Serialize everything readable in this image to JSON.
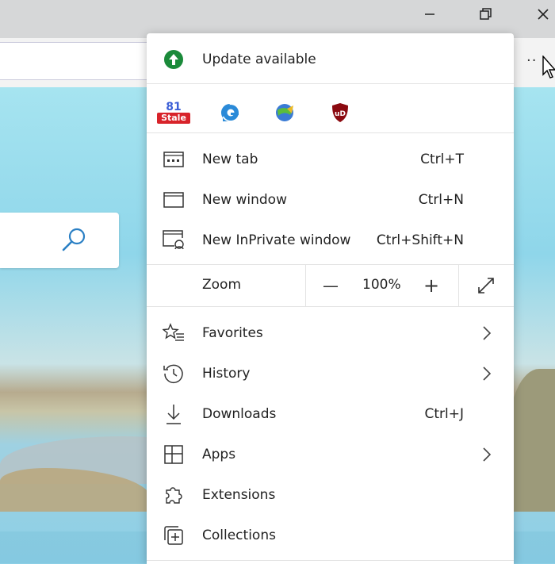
{
  "window": {
    "minimize_icon": "minimize-icon",
    "restore_icon": "restore-icon",
    "close_icon": "close-icon"
  },
  "toolbar": {
    "more_label": "··"
  },
  "menu": {
    "update": {
      "label": "Update available",
      "icon": "update-arrow-icon",
      "color": "#1a8a3a"
    },
    "extensions": [
      {
        "name": "stale-extension",
        "badge_top": "81",
        "badge_bottom": "Stale"
      },
      {
        "name": "edge-extension"
      },
      {
        "name": "idm-extension"
      },
      {
        "name": "ublock-extension",
        "text": "uD"
      }
    ],
    "items": [
      {
        "label": "New tab",
        "shortcut": "Ctrl+T"
      },
      {
        "label": "New window",
        "shortcut": "Ctrl+N"
      },
      {
        "label": "New InPrivate window",
        "shortcut": "Ctrl+Shift+N"
      }
    ],
    "zoom": {
      "label": "Zoom",
      "minus": "—",
      "value": "100%",
      "plus": "+"
    },
    "items2": [
      {
        "label": "Favorites"
      },
      {
        "label": "History"
      },
      {
        "label": "Downloads",
        "shortcut": "Ctrl+J"
      },
      {
        "label": "Apps"
      },
      {
        "label": "Extensions"
      },
      {
        "label": "Collections"
      }
    ]
  }
}
